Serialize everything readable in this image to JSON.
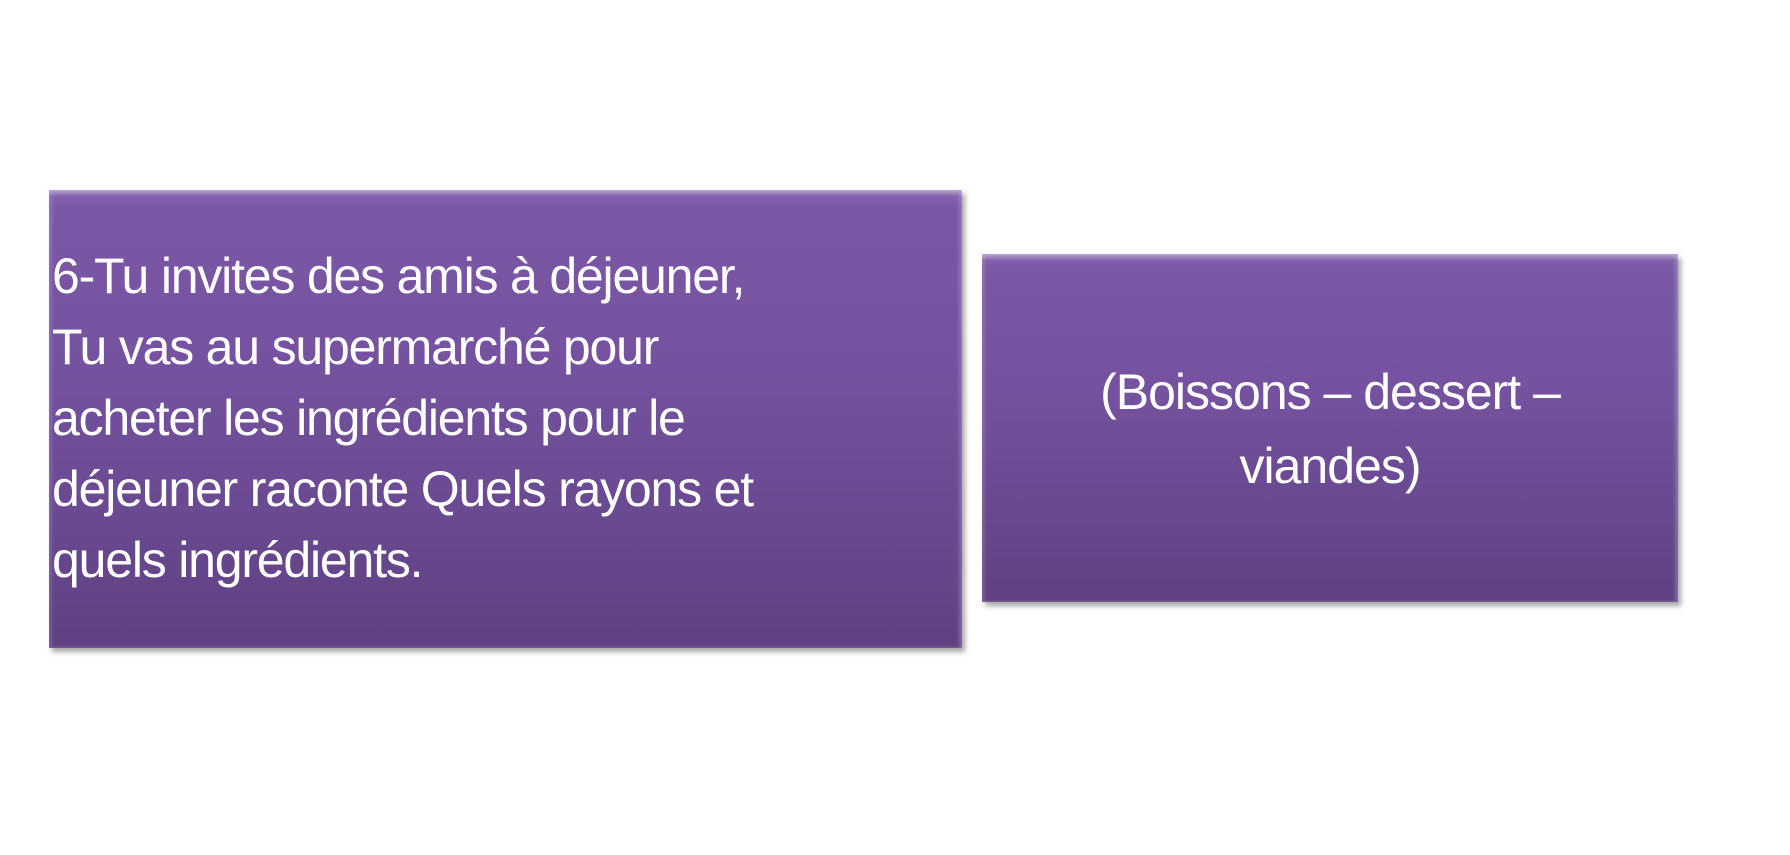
{
  "slide": {
    "question_box": {
      "lines": [
        "6-Tu invites des amis à déjeuner,",
        "Tu vas au supermarché pour",
        "acheter les ingrédients pour le",
        "déjeuner raconte Quels rayons et",
        "quels ingrédients."
      ]
    },
    "hint_box": {
      "lines": [
        "(Boissons – dessert –",
        "viandes)"
      ]
    },
    "colors": {
      "box_fill": "#74529f",
      "text": "#ffffff",
      "background": "#ffffff"
    }
  }
}
